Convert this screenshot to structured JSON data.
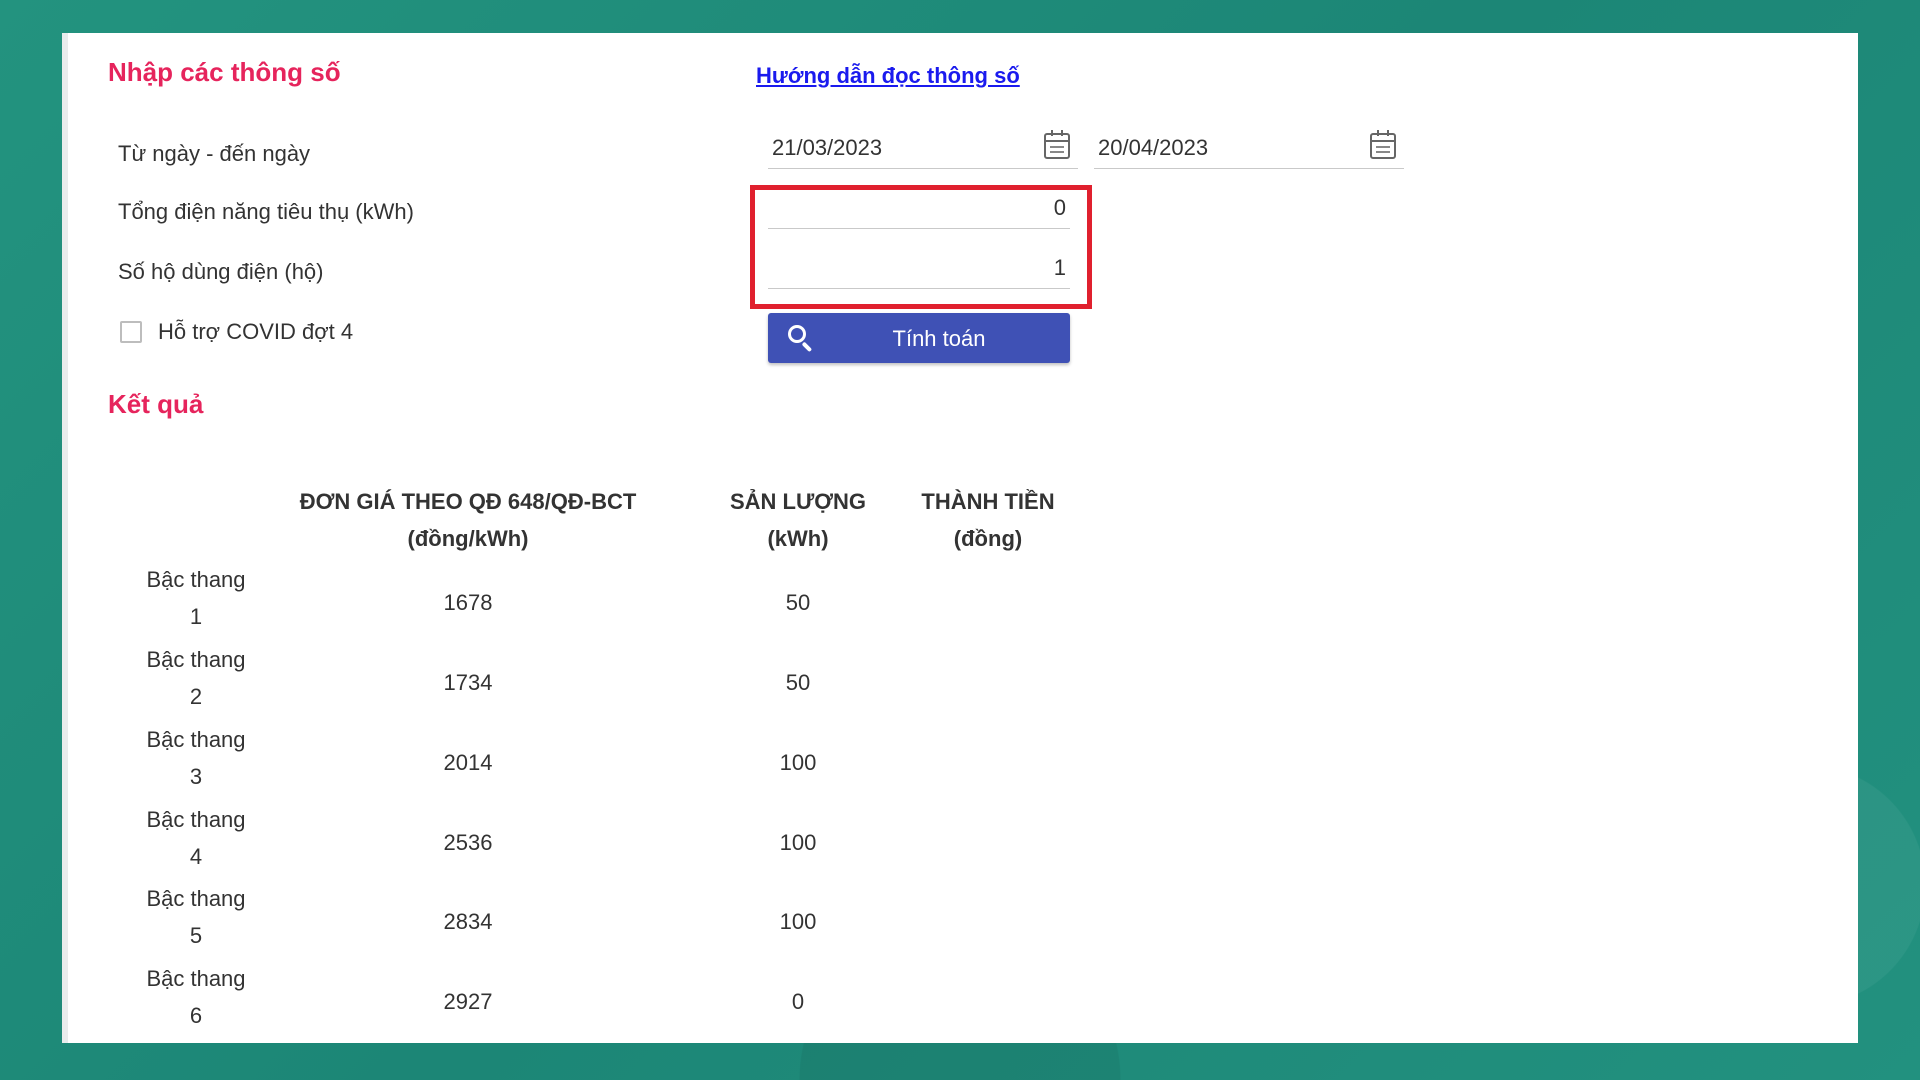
{
  "form": {
    "title": "Nhập các thông số",
    "help_link": "Hướng dẫn đọc thông số",
    "date_range_label": "Từ ngày - đến ngày",
    "from_date": "21/03/2023",
    "to_date": "20/04/2023",
    "consumption_label": "Tổng điện năng tiêu thụ (kWh)",
    "consumption_value": "0",
    "households_label": "Số hộ dùng điện (hộ)",
    "households_value": "1",
    "covid_label": "Hỗ trợ COVID đợt 4",
    "covid_checked": false,
    "calculate_button": "Tính toán"
  },
  "result": {
    "title": "Kết quả",
    "headers": [
      {
        "line1": "ĐƠN GIÁ THEO QĐ 648/QĐ-BCT",
        "line2": "(đồng/kWh)"
      },
      {
        "line1": "SẢN LƯỢNG",
        "line2": "(kWh)"
      },
      {
        "line1": "THÀNH TIỀN",
        "line2": "(đồng)"
      }
    ],
    "rows": [
      {
        "tier_line1": "Bậc thang",
        "tier_line2": "1",
        "price": "1678",
        "volume": "50",
        "amount": ""
      },
      {
        "tier_line1": "Bậc thang",
        "tier_line2": "2",
        "price": "1734",
        "volume": "50",
        "amount": ""
      },
      {
        "tier_line1": "Bậc thang",
        "tier_line2": "3",
        "price": "2014",
        "volume": "100",
        "amount": ""
      },
      {
        "tier_line1": "Bậc thang",
        "tier_line2": "4",
        "price": "2536",
        "volume": "100",
        "amount": ""
      },
      {
        "tier_line1": "Bậc thang",
        "tier_line2": "5",
        "price": "2834",
        "volume": "100",
        "amount": ""
      },
      {
        "tier_line1": "Bậc thang",
        "tier_line2": "6",
        "price": "2927",
        "volume": "0",
        "amount": ""
      }
    ]
  },
  "icons": {
    "calendar": "calendar-icon",
    "search": "search-icon"
  },
  "colors": {
    "section_title": "#e6245c",
    "link": "#1a1aee",
    "button": "#3f51b5",
    "highlight": "#e0202e",
    "background": "#1f8c7e"
  }
}
